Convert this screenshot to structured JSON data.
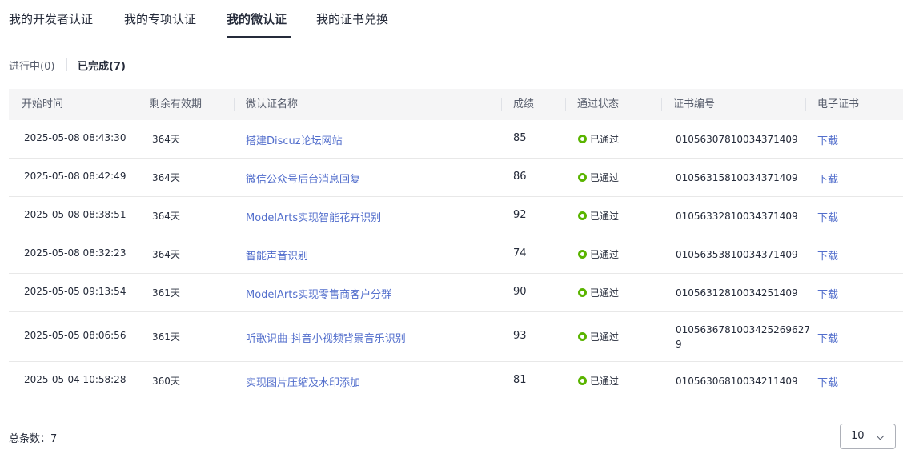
{
  "tabs": [
    "我的开发者认证",
    "我的专项认证",
    "我的微认证",
    "我的证书兑换"
  ],
  "active_tab": "我的微认证",
  "subtabs": {
    "in_progress": "进行中(0)",
    "completed": "已完成(7)"
  },
  "columns": [
    "开始时间",
    "剩余有效期",
    "微认证名称",
    "成绩",
    "通过状态",
    "证书编号",
    "电子证书"
  ],
  "rows": [
    {
      "start": "2025-05-08 08:43:30",
      "remaining": "364天",
      "name": "搭建Discuz论坛网站",
      "score": "85",
      "status": "已通过",
      "cert": "01056307810034371409",
      "download": "下载"
    },
    {
      "start": "2025-05-08 08:42:49",
      "remaining": "364天",
      "name": "微信公众号后台消息回复",
      "score": "86",
      "status": "已通过",
      "cert": "01056315810034371409",
      "download": "下载"
    },
    {
      "start": "2025-05-08 08:38:51",
      "remaining": "364天",
      "name": "ModelArts实现智能花卉识别",
      "score": "92",
      "status": "已通过",
      "cert": "01056332810034371409",
      "download": "下载"
    },
    {
      "start": "2025-05-08 08:32:23",
      "remaining": "364天",
      "name": "智能声音识别",
      "score": "74",
      "status": "已通过",
      "cert": "01056353810034371409",
      "download": "下载"
    },
    {
      "start": "2025-05-05 09:13:54",
      "remaining": "361天",
      "name": "ModelArts实现零售商客户分群",
      "score": "90",
      "status": "已通过",
      "cert": "01056312810034251409",
      "download": "下载"
    },
    {
      "start": "2025-05-05 08:06:56",
      "remaining": "361天",
      "name": "听歌识曲-抖音小视频背景音乐识别",
      "score": "93",
      "status": "已通过",
      "cert": "0105636781003425269627 9",
      "download": "下载"
    },
    {
      "start": "2025-05-04 10:58:28",
      "remaining": "360天",
      "name": "实现图片压缩及水印添加",
      "score": "81",
      "status": "已通过",
      "cert": "01056306810034211409",
      "download": "下载"
    }
  ],
  "footer": {
    "total_label": "总条数：7",
    "page_size": "10"
  },
  "colors": {
    "link": "#526ecc",
    "status_passed": "#5ab400",
    "header_bg": "#f5f5f6"
  }
}
